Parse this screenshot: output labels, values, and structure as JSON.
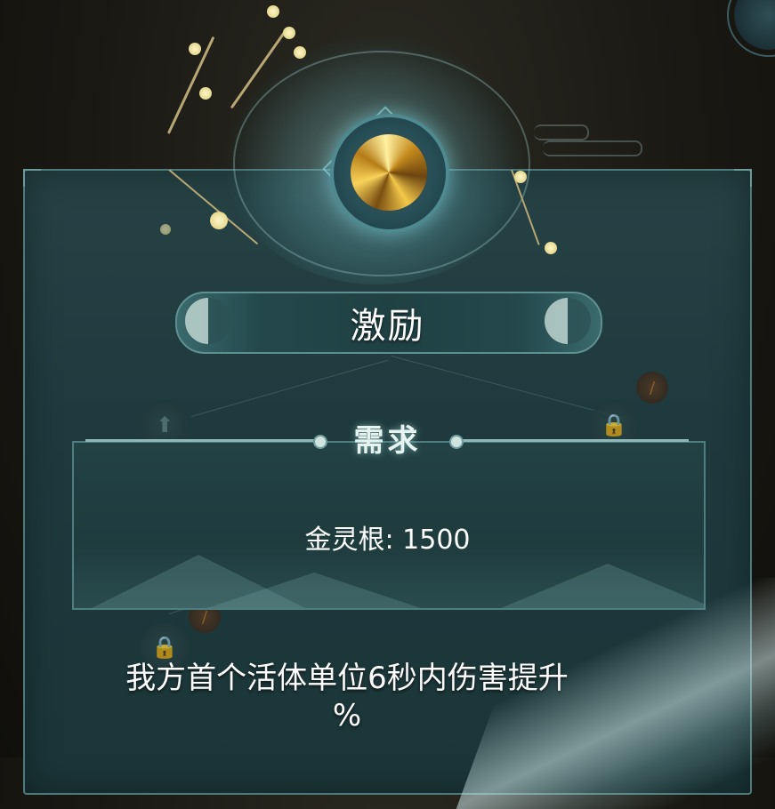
{
  "skill": {
    "title": "激励",
    "icon": "gold-element-orb-icon"
  },
  "requirement": {
    "header": "需求",
    "value": "金灵根: 1500"
  },
  "description": {
    "line1": "我方首个活体单位6秒内伤害提升",
    "line2": "%"
  },
  "nodes": [
    {
      "icon": "arrow-up-icon",
      "state": "locked"
    },
    {
      "icon": "lock-icon",
      "state": "locked"
    },
    {
      "icon": "lock-icon",
      "state": "locked"
    },
    {
      "icon": "fire-icon",
      "state": "inactive"
    },
    {
      "icon": "fire-icon",
      "state": "inactive"
    }
  ],
  "colors": {
    "panel": "#1e3a3e",
    "border": "#4f7a7c",
    "accent_gold": "#f8d35a",
    "text": "#ffffff"
  }
}
